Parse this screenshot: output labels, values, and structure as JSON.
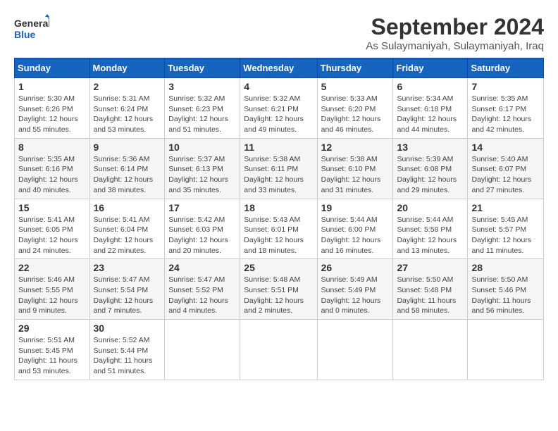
{
  "logo": {
    "line1": "General",
    "line2": "Blue"
  },
  "title": "September 2024",
  "location": "As Sulaymaniyah, Sulaymaniyah, Iraq",
  "days_of_week": [
    "Sunday",
    "Monday",
    "Tuesday",
    "Wednesday",
    "Thursday",
    "Friday",
    "Saturday"
  ],
  "weeks": [
    [
      {
        "day": "1",
        "sunrise": "5:30 AM",
        "sunset": "6:26 PM",
        "daylight": "12 hours and 55 minutes."
      },
      {
        "day": "2",
        "sunrise": "5:31 AM",
        "sunset": "6:24 PM",
        "daylight": "12 hours and 53 minutes."
      },
      {
        "day": "3",
        "sunrise": "5:32 AM",
        "sunset": "6:23 PM",
        "daylight": "12 hours and 51 minutes."
      },
      {
        "day": "4",
        "sunrise": "5:32 AM",
        "sunset": "6:21 PM",
        "daylight": "12 hours and 49 minutes."
      },
      {
        "day": "5",
        "sunrise": "5:33 AM",
        "sunset": "6:20 PM",
        "daylight": "12 hours and 46 minutes."
      },
      {
        "day": "6",
        "sunrise": "5:34 AM",
        "sunset": "6:18 PM",
        "daylight": "12 hours and 44 minutes."
      },
      {
        "day": "7",
        "sunrise": "5:35 AM",
        "sunset": "6:17 PM",
        "daylight": "12 hours and 42 minutes."
      }
    ],
    [
      {
        "day": "8",
        "sunrise": "5:35 AM",
        "sunset": "6:16 PM",
        "daylight": "12 hours and 40 minutes."
      },
      {
        "day": "9",
        "sunrise": "5:36 AM",
        "sunset": "6:14 PM",
        "daylight": "12 hours and 38 minutes."
      },
      {
        "day": "10",
        "sunrise": "5:37 AM",
        "sunset": "6:13 PM",
        "daylight": "12 hours and 35 minutes."
      },
      {
        "day": "11",
        "sunrise": "5:38 AM",
        "sunset": "6:11 PM",
        "daylight": "12 hours and 33 minutes."
      },
      {
        "day": "12",
        "sunrise": "5:38 AM",
        "sunset": "6:10 PM",
        "daylight": "12 hours and 31 minutes."
      },
      {
        "day": "13",
        "sunrise": "5:39 AM",
        "sunset": "6:08 PM",
        "daylight": "12 hours and 29 minutes."
      },
      {
        "day": "14",
        "sunrise": "5:40 AM",
        "sunset": "6:07 PM",
        "daylight": "12 hours and 27 minutes."
      }
    ],
    [
      {
        "day": "15",
        "sunrise": "5:41 AM",
        "sunset": "6:05 PM",
        "daylight": "12 hours and 24 minutes."
      },
      {
        "day": "16",
        "sunrise": "5:41 AM",
        "sunset": "6:04 PM",
        "daylight": "12 hours and 22 minutes."
      },
      {
        "day": "17",
        "sunrise": "5:42 AM",
        "sunset": "6:03 PM",
        "daylight": "12 hours and 20 minutes."
      },
      {
        "day": "18",
        "sunrise": "5:43 AM",
        "sunset": "6:01 PM",
        "daylight": "12 hours and 18 minutes."
      },
      {
        "day": "19",
        "sunrise": "5:44 AM",
        "sunset": "6:00 PM",
        "daylight": "12 hours and 16 minutes."
      },
      {
        "day": "20",
        "sunrise": "5:44 AM",
        "sunset": "5:58 PM",
        "daylight": "12 hours and 13 minutes."
      },
      {
        "day": "21",
        "sunrise": "5:45 AM",
        "sunset": "5:57 PM",
        "daylight": "12 hours and 11 minutes."
      }
    ],
    [
      {
        "day": "22",
        "sunrise": "5:46 AM",
        "sunset": "5:55 PM",
        "daylight": "12 hours and 9 minutes."
      },
      {
        "day": "23",
        "sunrise": "5:47 AM",
        "sunset": "5:54 PM",
        "daylight": "12 hours and 7 minutes."
      },
      {
        "day": "24",
        "sunrise": "5:47 AM",
        "sunset": "5:52 PM",
        "daylight": "12 hours and 4 minutes."
      },
      {
        "day": "25",
        "sunrise": "5:48 AM",
        "sunset": "5:51 PM",
        "daylight": "12 hours and 2 minutes."
      },
      {
        "day": "26",
        "sunrise": "5:49 AM",
        "sunset": "5:49 PM",
        "daylight": "12 hours and 0 minutes."
      },
      {
        "day": "27",
        "sunrise": "5:50 AM",
        "sunset": "5:48 PM",
        "daylight": "11 hours and 58 minutes."
      },
      {
        "day": "28",
        "sunrise": "5:50 AM",
        "sunset": "5:46 PM",
        "daylight": "11 hours and 56 minutes."
      }
    ],
    [
      {
        "day": "29",
        "sunrise": "5:51 AM",
        "sunset": "5:45 PM",
        "daylight": "11 hours and 53 minutes."
      },
      {
        "day": "30",
        "sunrise": "5:52 AM",
        "sunset": "5:44 PM",
        "daylight": "11 hours and 51 minutes."
      },
      null,
      null,
      null,
      null,
      null
    ]
  ]
}
